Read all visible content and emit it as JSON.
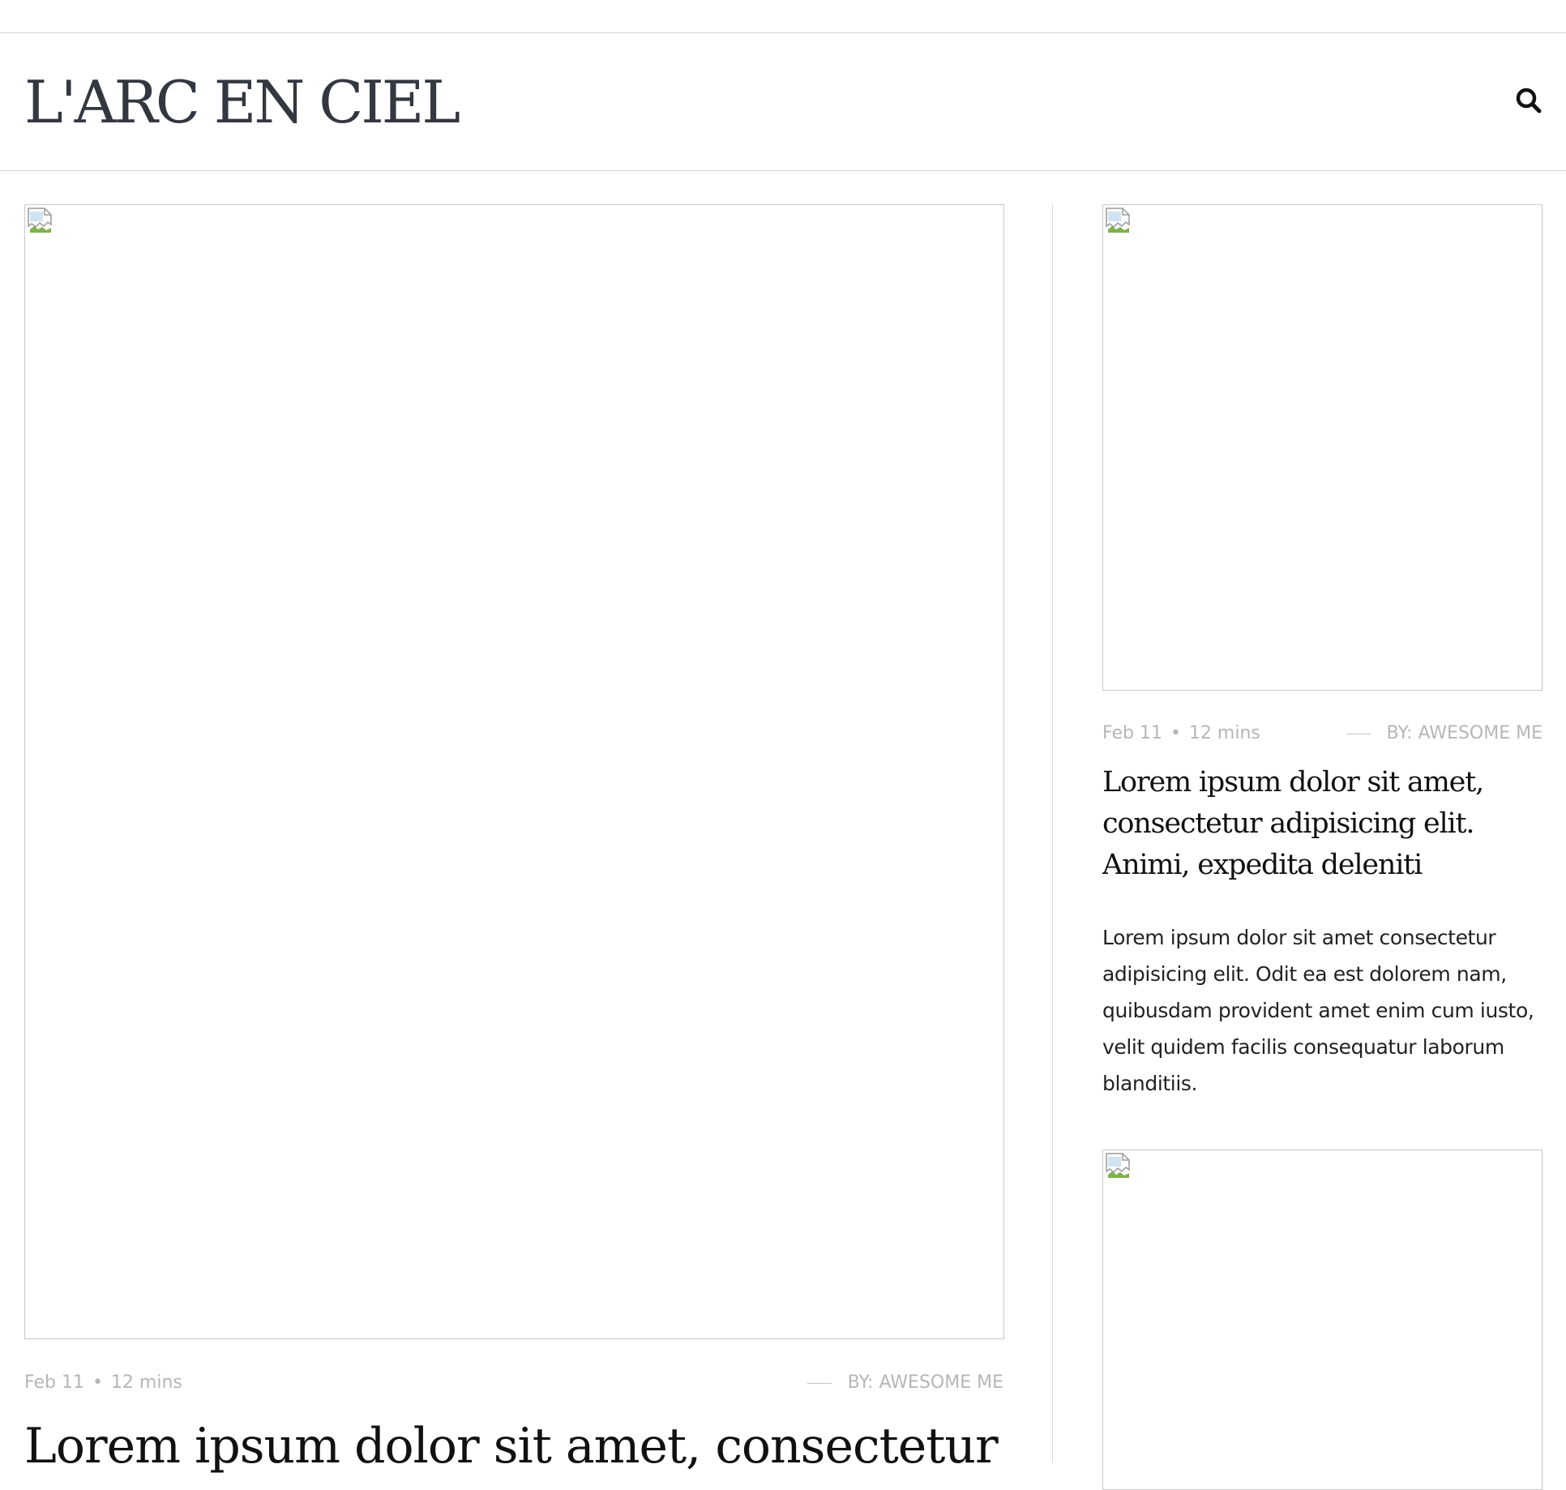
{
  "site": {
    "logo": "L'ARC EN CIEL",
    "search_icon": "search-icon"
  },
  "featured": {
    "date": "Feb 11",
    "separator": "•",
    "read_time": "12 mins",
    "author": "BY: AWESOME ME",
    "title": "Lorem ipsum dolor sit amet, consectetur"
  },
  "side_posts": [
    {
      "date": "Feb 11",
      "separator": "•",
      "read_time": "12 mins",
      "author": "BY: AWESOME ME",
      "title": "Lorem ipsum dolor sit amet, consectetur adipisicing elit. Animi, expedita deleniti",
      "excerpt": "Lorem ipsum dolor sit amet consectetur adipisicing elit. Odit ea est dolorem nam, quibusdam provident amet enim cum iusto, velit quidem facilis consequatur laborum blanditiis."
    }
  ]
}
